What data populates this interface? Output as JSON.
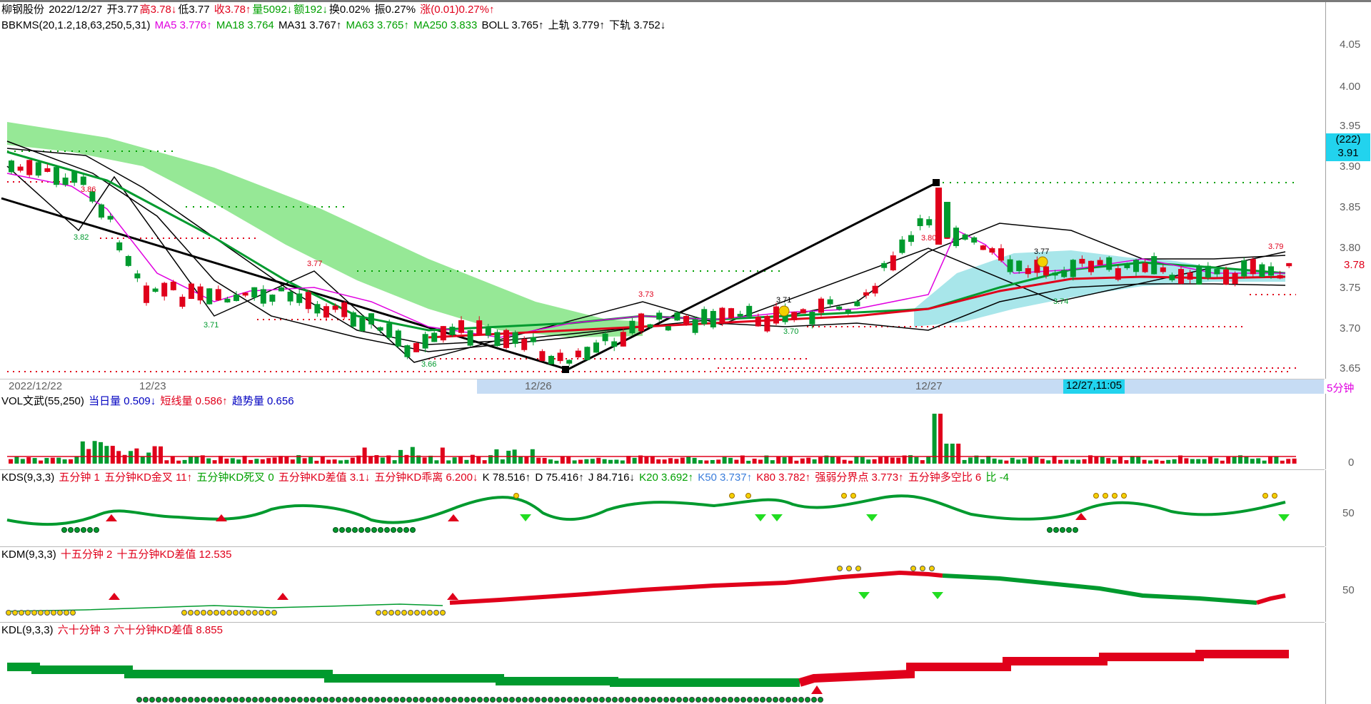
{
  "quote": {
    "name": "柳钢股份",
    "date": "2022/12/27",
    "open": "开3.77",
    "high": "高3.78↓",
    "low": "低3.77",
    "close": "收3.78↑",
    "volume": "量5092↓",
    "amount": "额192↓",
    "turnover": "换0.02%",
    "amplitude": "振0.27%",
    "change": "涨(0.01)0.27%↑"
  },
  "main_indicator": {
    "name": "BBKMS(20,1.2,18,63,250,5,31)",
    "ma5": "MA5 3.776↑",
    "ma18": "MA18 3.764",
    "ma31": "MA31 3.767↑",
    "ma63": "MA63 3.765↑",
    "ma250": "MA250 3.833",
    "boll": "BOLL 3.765↑",
    "upper": "上轨 3.779↑",
    "lower": "下轨 3.752↓"
  },
  "price_axis": {
    "ticks": [
      "4.05",
      "4.00",
      "3.95",
      "3.90",
      "3.85",
      "3.80",
      "3.75",
      "3.70",
      "3.65"
    ],
    "badge_count": "(222)",
    "badge_price": "3.91",
    "current_price": "3.78"
  },
  "price_labels": {
    "l386": "3.86",
    "l382": "3.82",
    "l377": "3.77",
    "l371": "3.71",
    "l366": "3.66",
    "l373": "3.73",
    "l371b": "3.71",
    "l370": "3.70",
    "l380": "3.80",
    "l377b": "3.77",
    "l374": "3.74",
    "l379": "3.79"
  },
  "date_axis": {
    "d1": "2022/12/22",
    "d2": "12/23",
    "d3": "12/26",
    "d4": "12/27",
    "cursor": "12/27,11:05",
    "period": "5分钟"
  },
  "vol_panel": {
    "name": "VOL文武(55,250)",
    "today": "当日量 0.509↓",
    "short": "短线量 0.586↑",
    "trend": "趋势量 0.656",
    "axis0": "0"
  },
  "kds_panel": {
    "name": "KDS(9,3,3)",
    "a": "五分钟 1",
    "b": "五分钟KD金叉 11↑",
    "c": "五分钟KD死叉 0",
    "d": "五分钟KD差值 3.1↓",
    "e": "五分钟KD乖离 6.200↓",
    "k": "K 78.516↑",
    "dd": "D 75.416↑",
    "j": "J 84.716↓",
    "k20": "K20 3.692↑",
    "k50": "K50 3.737↑",
    "k80": "K80 3.782↑",
    "f": "强弱分界点 3.773↑",
    "g": "五分钟多空比 6",
    "h": "比 -4",
    "axis50": "50"
  },
  "kdm_panel": {
    "name": "KDM(9,3,3)",
    "a": "十五分钟 2",
    "b": "十五分钟KD差值 12.535",
    "axis50": "50"
  },
  "kdl_panel": {
    "name": "KDL(9,3,3)",
    "a": "六十分钟 3",
    "b": "六十分钟KD差值 8.855"
  },
  "colors": {
    "up": "#e0001b",
    "down": "#009a2e",
    "band": "#8be68b",
    "band2": "#a8e6ea",
    "cursor": "#22d3ee"
  }
}
